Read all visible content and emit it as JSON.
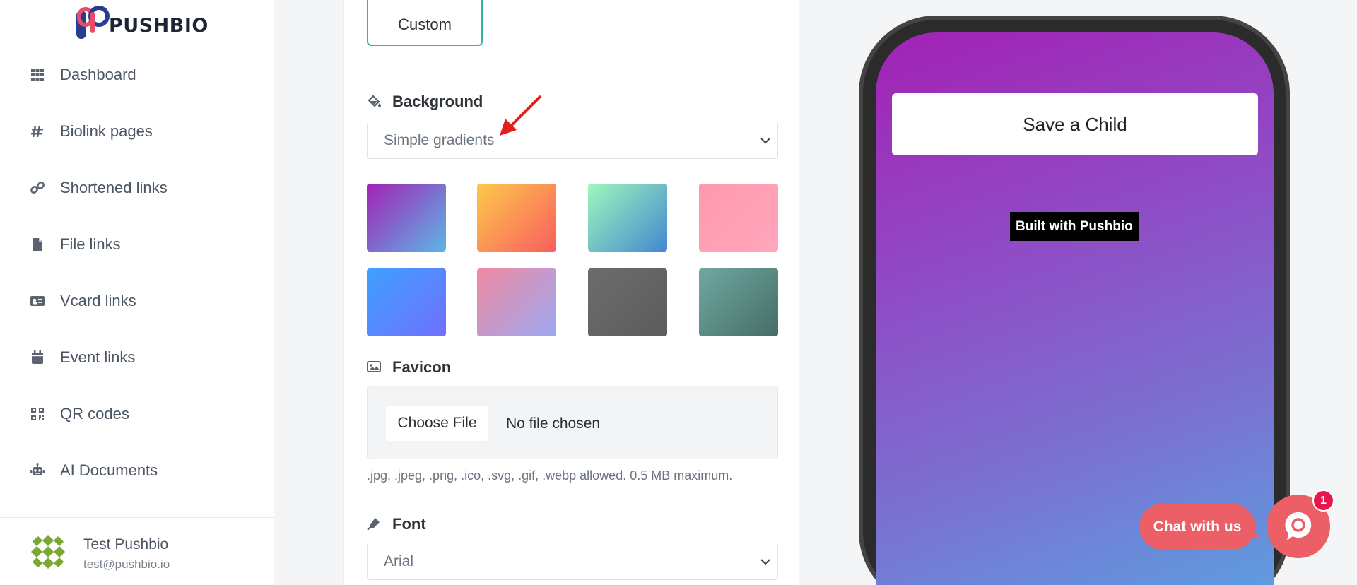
{
  "brand": {
    "name": "PUSHBIO"
  },
  "sidebar": {
    "items": [
      {
        "label": "Dashboard",
        "icon": "grid-icon"
      },
      {
        "label": "Biolink pages",
        "icon": "hash-icon"
      },
      {
        "label": "Shortened links",
        "icon": "link-icon"
      },
      {
        "label": "File links",
        "icon": "file-icon"
      },
      {
        "label": "Vcard links",
        "icon": "id-card-icon"
      },
      {
        "label": "Event links",
        "icon": "calendar-icon"
      },
      {
        "label": "QR codes",
        "icon": "qrcode-icon"
      },
      {
        "label": "AI Documents",
        "icon": "robot-icon"
      }
    ],
    "user": {
      "name": "Test Pushbio",
      "email": "test@pushbio.io"
    }
  },
  "editor": {
    "custom_label": "Custom",
    "background": {
      "label": "Background",
      "selected": "Simple gradients"
    },
    "gradients": [
      {
        "from": "#a322b5",
        "to": "#5cb6e6"
      },
      {
        "from": "#fcc94c",
        "to": "#fa5d5f"
      },
      {
        "from": "#9ef7bd",
        "to": "#4587cf"
      },
      {
        "from": "#ff99ad",
        "to": "#ffa6bd"
      },
      {
        "from": "#3fa0ff",
        "to": "#6f70fe"
      },
      {
        "from": "#f08aa2",
        "to": "#9ca8f2"
      },
      {
        "from": "#6c6c6c",
        "to": "#5c5c5c"
      },
      {
        "from": "#6fa8a0",
        "to": "#466d68"
      }
    ],
    "favicon": {
      "label": "Favicon",
      "choose_label": "Choose File",
      "status": "No file chosen",
      "hint": ".jpg, .jpeg, .png, .ico, .svg, .gif, .webp allowed. 0.5 MB maximum."
    },
    "font": {
      "label": "Font",
      "selected": "Arial"
    }
  },
  "preview": {
    "link_label": "Save a Child",
    "branding": "Built with Pushbio"
  },
  "chat": {
    "label": "Chat with us",
    "badge": "1"
  },
  "colors": {
    "accent": "#35b3a2",
    "chat": "#ec5f66",
    "badge": "#e5174c"
  }
}
